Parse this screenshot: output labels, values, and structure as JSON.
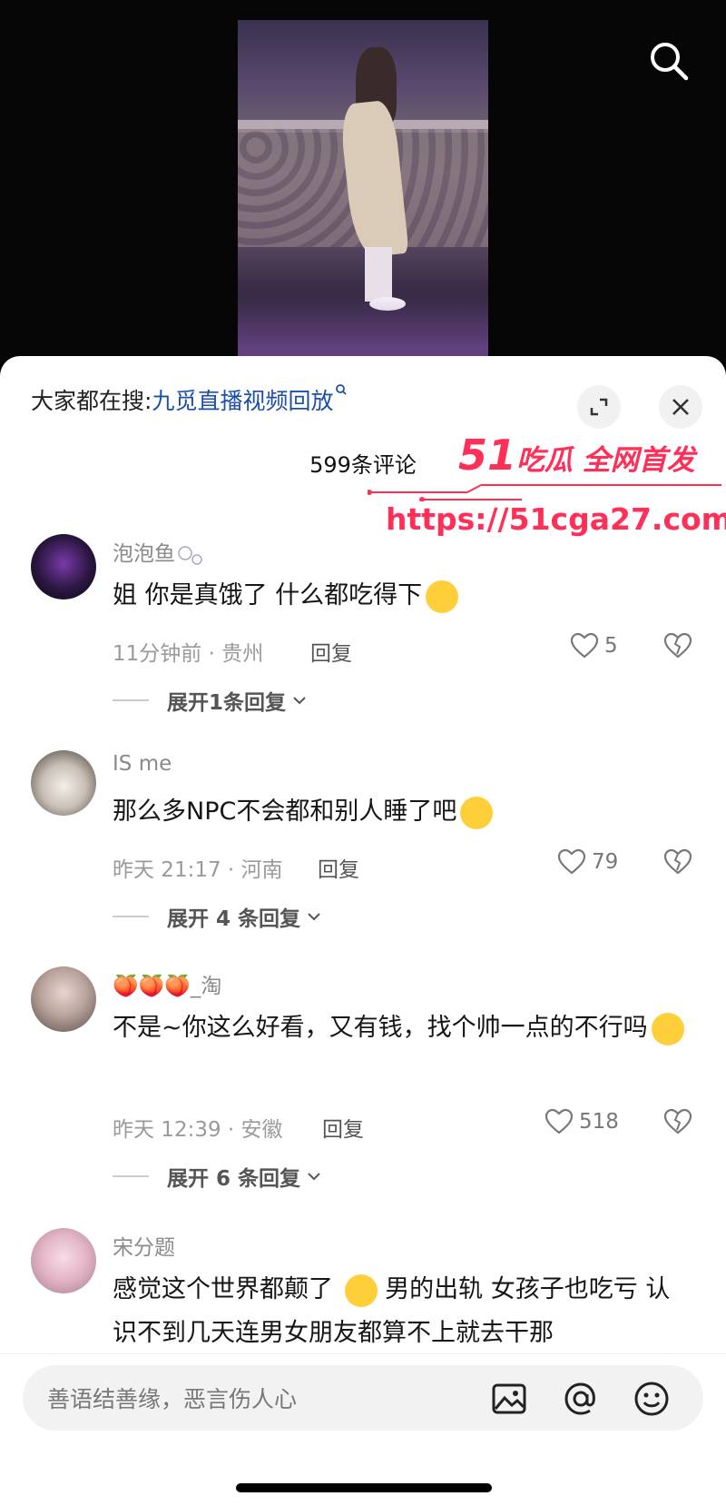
{
  "trending": {
    "prefix": "大家都在搜:",
    "query": "九觅直播视频回放"
  },
  "comment_count": "599条评论",
  "watermark": {
    "brand_number": "51",
    "brand_text": "吃瓜 全网首发",
    "url": "https://51cga27.com"
  },
  "comments": [
    {
      "name": "泡泡鱼",
      "text": "姐 你是真饿了 什么都吃得下",
      "meta": "11分钟前 · 贵州",
      "reply": "回复",
      "likes": "5",
      "expand": "展开1条回复"
    },
    {
      "name": "IS me",
      "text": "那么多NPC不会都和别人睡了吧",
      "meta": "昨天 21:17 · 河南",
      "reply": "回复",
      "likes": "79",
      "expand": "展开 4 条回复"
    },
    {
      "name": "🍑🍑🍑_淘",
      "text": "不是~你这么好看，又有钱，找个帅一点的不行吗",
      "meta": "昨天 12:39 · 安徽",
      "reply": "回复",
      "likes": "518",
      "expand": "展开 6 条回复"
    },
    {
      "name": "宋分题",
      "text_a": "感觉这个世界都颠了",
      "text_b": "男的出轨 女孩子也吃亏 认识不到几天连男女朋友都算不上就去干那"
    }
  ],
  "input": {
    "placeholder": "善语结善缘，恶言伤人心"
  },
  "colors": {
    "link": "#1d4fa8",
    "watermark": "#ff2f57"
  }
}
